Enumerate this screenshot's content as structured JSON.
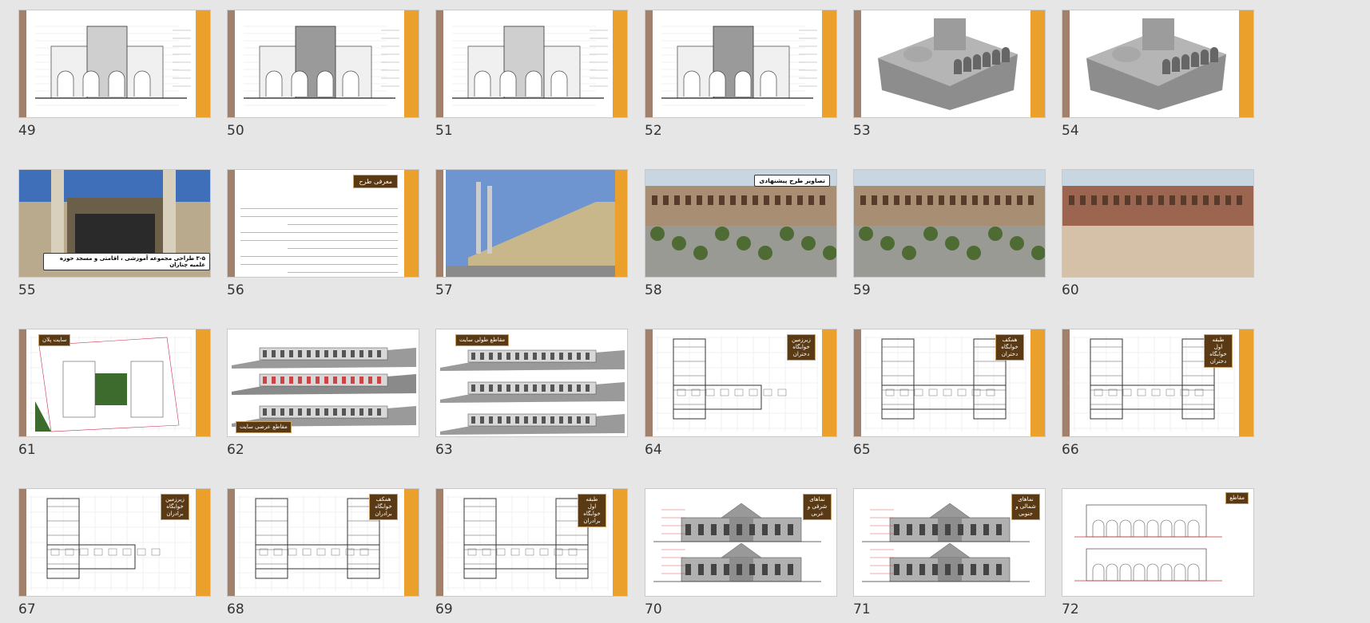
{
  "slides": [
    {
      "number": "49",
      "kind": "drawing"
    },
    {
      "number": "50",
      "kind": "drawing"
    },
    {
      "number": "51",
      "kind": "drawing"
    },
    {
      "number": "52",
      "kind": "drawing"
    },
    {
      "number": "53",
      "kind": "model"
    },
    {
      "number": "54",
      "kind": "model"
    },
    {
      "number": "55",
      "kind": "photo",
      "caption": "۳-۵ طراحی مجموعه آموزشی ، اقامتی و مسجد حوزه علمیه چناران"
    },
    {
      "number": "56",
      "kind": "text",
      "badge": "معرفی طرح"
    },
    {
      "number": "57",
      "kind": "photo"
    },
    {
      "number": "58",
      "kind": "render",
      "caption": "تصاویر طرح پیشنهادی"
    },
    {
      "number": "59",
      "kind": "render"
    },
    {
      "number": "60",
      "kind": "render"
    },
    {
      "number": "61",
      "kind": "plan",
      "badge": "سایت پلان"
    },
    {
      "number": "62",
      "kind": "section",
      "badge": "مقاطع عرضی سایت"
    },
    {
      "number": "63",
      "kind": "section",
      "badge": "مقاطع طولی سایت"
    },
    {
      "number": "64",
      "kind": "plan",
      "badge": "زیرزمین خوابگاه دختران"
    },
    {
      "number": "65",
      "kind": "plan",
      "badge": "همکف خوابگاه دختران"
    },
    {
      "number": "66",
      "kind": "plan",
      "badge": "طبقه اول خوابگاه دختران"
    },
    {
      "number": "67",
      "kind": "plan",
      "badge": "زیرزمین خوابگاه برادران"
    },
    {
      "number": "68",
      "kind": "plan",
      "badge": "همکف خوابگاه برادران"
    },
    {
      "number": "69",
      "kind": "plan",
      "badge": "طبقه اول خوابگاه برادران"
    },
    {
      "number": "70",
      "kind": "elevation",
      "badge": "نماهای شرقی و غربی"
    },
    {
      "number": "71",
      "kind": "elevation",
      "badge": "نماهای شمالی و جنوبی"
    },
    {
      "number": "72",
      "kind": "section",
      "badge": "مقاطع"
    }
  ]
}
